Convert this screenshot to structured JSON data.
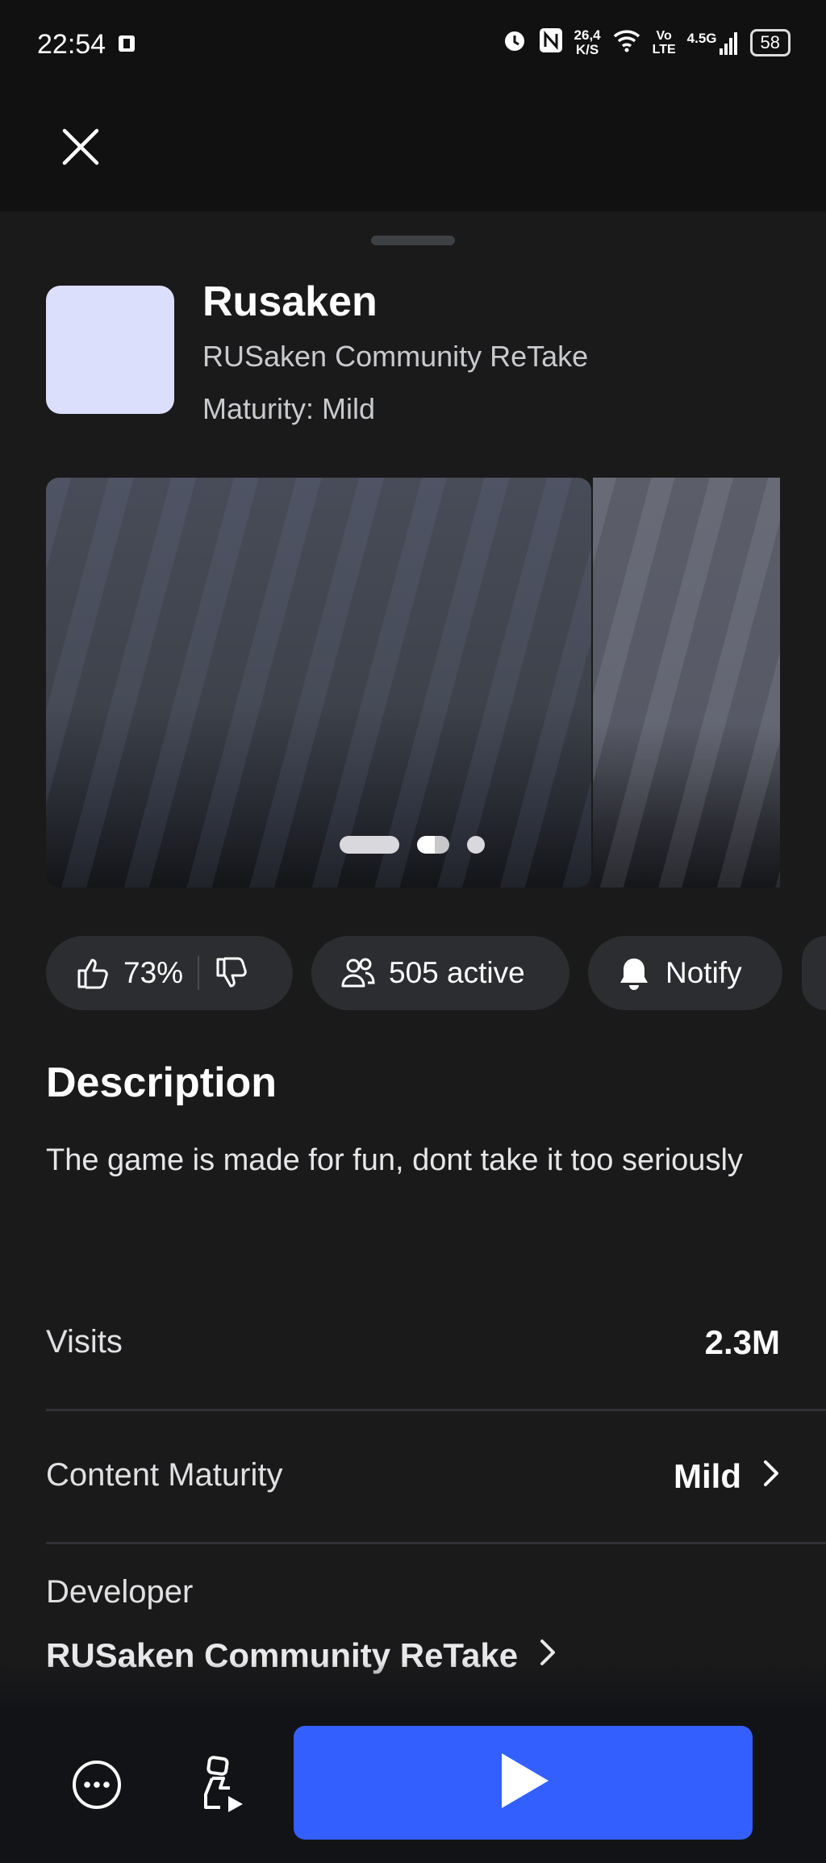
{
  "status_bar": {
    "time": "22:54",
    "network_speed_top": "26,4",
    "network_speed_bottom": "K/S",
    "volte_top": "Vo",
    "volte_bottom": "LTE",
    "network_type": "4.5G",
    "battery": "58"
  },
  "game": {
    "title": "Rusaken",
    "creator": "RUSaken Community ReTake",
    "maturity_line": "Maturity: Mild",
    "icon_color": "#dcdffc"
  },
  "carousel": {
    "slide_count": 3,
    "active_index": 1
  },
  "chips": {
    "rating": "73%",
    "active": "505 active",
    "notify": "Notify"
  },
  "description": {
    "heading": "Description",
    "text": "The game is made for fun, dont take it too seriously"
  },
  "info": {
    "visits_label": "Visits",
    "visits_value": "2.3M",
    "maturity_label": "Content Maturity",
    "maturity_value": "Mild",
    "developer_label": "Developer",
    "developer_value": "RUSaken Community ReTake"
  },
  "icons": {
    "close": "close-icon",
    "thumbs_up": "thumbs-up-icon",
    "thumbs_down": "thumbs-down-icon",
    "users": "users-icon",
    "bell": "bell-icon",
    "more": "more-icon",
    "avatar": "avatar-icon",
    "play": "play-icon",
    "chevron": "chevron-right-icon"
  },
  "colors": {
    "background": "#1a1a1b",
    "play_button": "#335fff",
    "chip": "#2c2d31"
  }
}
